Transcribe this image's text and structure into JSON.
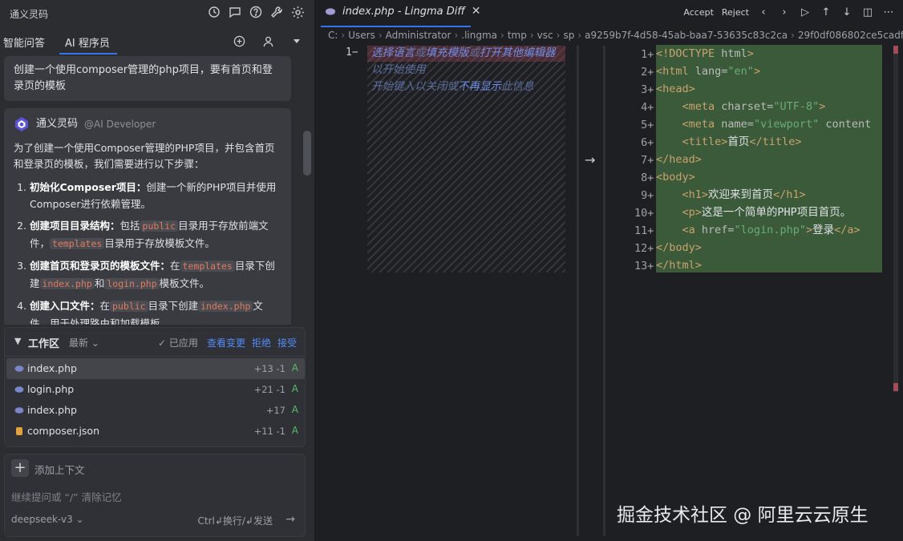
{
  "app": {
    "title": "通义灵码"
  },
  "tabs": [
    {
      "label": "智能问答"
    },
    {
      "label": "AI 程序员"
    }
  ],
  "chat": {
    "user_message": "创建一个使用composer管理的php项目，要有首页和登录页的模板",
    "assistant": {
      "name": "通义灵码",
      "role": "@AI Developer",
      "intro": "为了创建一个使用Composer管理的PHP项目，并包含首页和登录页的模板，我们需要进行以下步骤：",
      "steps": [
        {
          "title": "初始化Composer项目",
          "sep": "：",
          "text": "创建一个新的PHP项目并使用Composer进行依赖管理。"
        },
        {
          "title": "创建项目目录结构",
          "sep": "：",
          "p1": "包括",
          "c1": "public",
          "p2": "目录用于存放前端文件，",
          "c2": "templates",
          "p3": "目录用于存放模板文件。"
        },
        {
          "title": "创建首页和登录页的模板文件",
          "sep": "：",
          "p1": "在",
          "c1": "templates",
          "p2": "目录下创建",
          "c2": "index.php",
          "p3": "和",
          "c3": "login.php",
          "p4": "模板文件。"
        },
        {
          "title": "创建入口文件",
          "sep": "：",
          "p1": "在",
          "c1": "public",
          "p2": "目录下创建",
          "c2": "index.php",
          "p3": "文件，用于处理路由和加载模板。"
        }
      ]
    }
  },
  "workspace": {
    "title": "工作区",
    "sort": "最新",
    "applied": "已应用",
    "view_changes": "查看变更",
    "reject": "拒绝",
    "accept": "接受",
    "files": [
      {
        "name": "index.php",
        "diff": "+13 -1",
        "status": "A"
      },
      {
        "name": "login.php",
        "diff": "+21 -1",
        "status": "A"
      },
      {
        "name": "index.php",
        "diff": "+17",
        "status": "A"
      },
      {
        "name": "composer.json",
        "diff": "+11 -1",
        "status": "A"
      }
    ]
  },
  "input": {
    "add_context": "添加上下文",
    "placeholder": "继续提问或 “/” 清除记忆",
    "model": "deepseek-v3",
    "hint": "Ctrl↲换行/↲发送"
  },
  "editor": {
    "tab": "index.php - Lingma Diff",
    "accept": "Accept",
    "reject": "Reject",
    "breadcrumbs": [
      "C:",
      "Users",
      "Administrator",
      ".lingma",
      "tmp",
      "vsc",
      "sp",
      "a9259b7f-4d58-45ab-baa7-53635c83c2ca",
      "29f0df086802ce5cadfa7"
    ],
    "left_line": "1−",
    "left_hint": {
      "a": "选择语言",
      "b": "或",
      "c": "填充模版",
      "d": "或",
      "e": "打开其他编辑器",
      "f": "以开始使用",
      "g": "开始键入以关闭或",
      "h": "不再显示",
      "i": "此信息"
    },
    "right_lines": [
      "1+",
      "2+",
      "3+",
      "4+",
      "5+",
      "6+",
      "7+",
      "8+",
      "9+",
      "10+",
      "11+",
      "12+",
      "13+"
    ],
    "code": [
      [
        {
          "c": "tg",
          "t": "<!DOCTYPE "
        },
        {
          "c": "an",
          "t": "html"
        },
        {
          "c": "tg",
          "t": ">"
        }
      ],
      [
        {
          "c": "tg",
          "t": "<html "
        },
        {
          "c": "an",
          "t": "lang="
        },
        {
          "c": "av",
          "t": "\"en\""
        },
        {
          "c": "tg",
          "t": ">"
        }
      ],
      [
        {
          "c": "tg",
          "t": "<head>"
        }
      ],
      [
        {
          "c": "tx",
          "t": "    "
        },
        {
          "c": "tg",
          "t": "<meta "
        },
        {
          "c": "an",
          "t": "charset="
        },
        {
          "c": "av",
          "t": "\"UTF-8\""
        },
        {
          "c": "tg",
          "t": ">"
        }
      ],
      [
        {
          "c": "tx",
          "t": "    "
        },
        {
          "c": "tg",
          "t": "<meta "
        },
        {
          "c": "an",
          "t": "name="
        },
        {
          "c": "av",
          "t": "\"viewport\""
        },
        {
          "c": "an",
          "t": " content"
        }
      ],
      [
        {
          "c": "tx",
          "t": "    "
        },
        {
          "c": "tg",
          "t": "<title>"
        },
        {
          "c": "tx",
          "t": "首页"
        },
        {
          "c": "tg",
          "t": "</title>"
        }
      ],
      [
        {
          "c": "tg",
          "t": "</head>"
        }
      ],
      [
        {
          "c": "tg",
          "t": "<body>"
        }
      ],
      [
        {
          "c": "tx",
          "t": "    "
        },
        {
          "c": "tg",
          "t": "<h1>"
        },
        {
          "c": "tx",
          "t": "欢迎来到首页"
        },
        {
          "c": "tg",
          "t": "</h1>"
        }
      ],
      [
        {
          "c": "tx",
          "t": "    "
        },
        {
          "c": "tg",
          "t": "<p>"
        },
        {
          "c": "tx",
          "t": "这是一个简单的PHP项目首页。"
        }
      ],
      [
        {
          "c": "tx",
          "t": "    "
        },
        {
          "c": "tg",
          "t": "<a "
        },
        {
          "c": "an",
          "t": "href="
        },
        {
          "c": "av",
          "t": "\"login.php\""
        },
        {
          "c": "tg",
          "t": ">"
        },
        {
          "c": "tx",
          "t": "登录"
        },
        {
          "c": "tg",
          "t": "</a>"
        }
      ],
      [
        {
          "c": "tg",
          "t": "</body>"
        }
      ],
      [
        {
          "c": "tg",
          "t": "</html>"
        }
      ]
    ]
  },
  "watermark": "掘金技术社区 @ 阿里云云原生",
  "colors": {
    "accent": "#3574f0",
    "link": "#548af7",
    "added_bg": "#3b5a3a",
    "added_letter": "#5fb865"
  }
}
